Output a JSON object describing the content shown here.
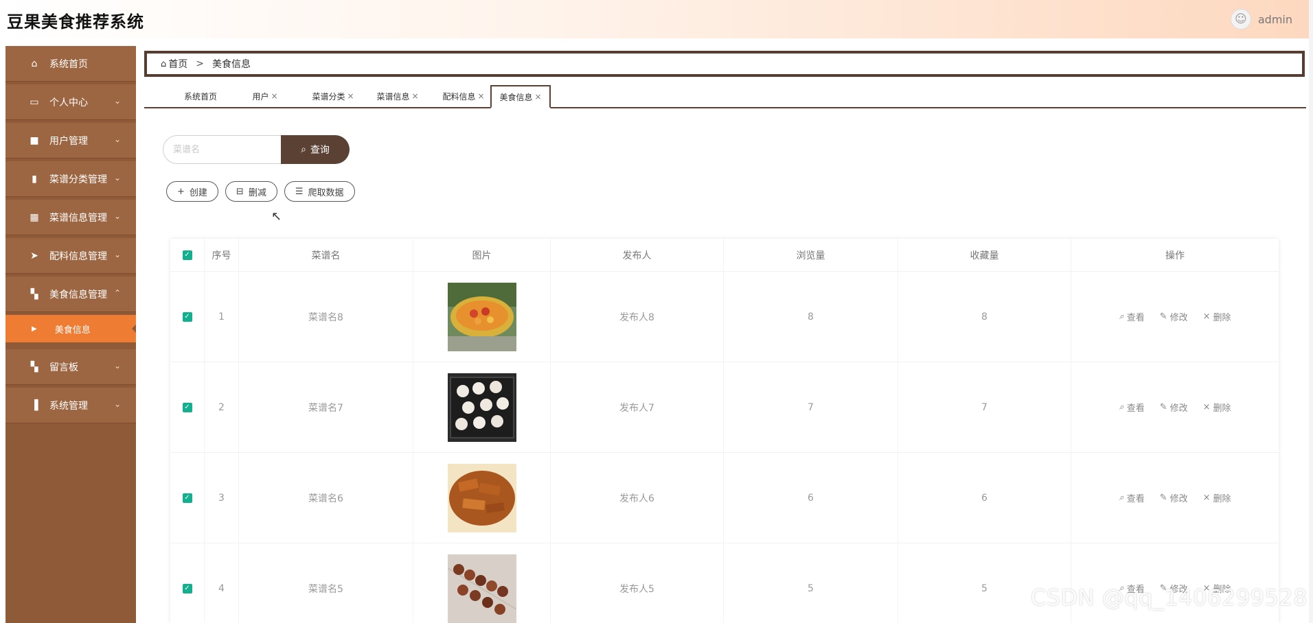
{
  "header": {
    "title": "豆果美食推荐系统",
    "username": "admin"
  },
  "sidebar": {
    "items": [
      {
        "label": "系统首页",
        "icon": "home-icon"
      },
      {
        "label": "个人中心",
        "icon": "card-icon"
      },
      {
        "label": "用户管理",
        "icon": "briefcase-icon"
      },
      {
        "label": "菜谱分类管理",
        "icon": "clipboard-icon"
      },
      {
        "label": "菜谱信息管理",
        "icon": "grid-icon"
      },
      {
        "label": "配料信息管理",
        "icon": "send-icon"
      },
      {
        "label": "美食信息管理",
        "icon": "tiles-icon"
      },
      {
        "label": "留言板",
        "icon": "tiles-icon"
      },
      {
        "label": "系统管理",
        "icon": "bar-chart-icon"
      }
    ],
    "active_sub": "美食信息"
  },
  "breadcrumb": {
    "home": "首页",
    "sep": ">",
    "current": "美食信息"
  },
  "tabs": [
    {
      "label": "系统首页"
    },
    {
      "label": "用户"
    },
    {
      "label": "菜谱分类"
    },
    {
      "label": "菜谱信息"
    },
    {
      "label": "配料信息"
    },
    {
      "label": "美食信息"
    }
  ],
  "search": {
    "placeholder": "菜谱名",
    "button": "查询"
  },
  "actions": {
    "create": "创建",
    "delete": "删减",
    "crawl": "爬取数据"
  },
  "table": {
    "columns": [
      "序号",
      "菜谱名",
      "图片",
      "发布人",
      "浏览量",
      "收藏量",
      "操作"
    ],
    "ops": {
      "view": "查看",
      "edit": "修改",
      "delete": "删除"
    },
    "rows": [
      {
        "no": "1",
        "name": "菜谱名8",
        "publisher": "发布人8",
        "views": "8",
        "favs": "8",
        "image": "pineapple-rice-photo"
      },
      {
        "no": "2",
        "name": "菜谱名7",
        "publisher": "发布人7",
        "views": "7",
        "favs": "7",
        "image": "dumplings-photo"
      },
      {
        "no": "3",
        "name": "菜谱名6",
        "publisher": "发布人6",
        "views": "6",
        "favs": "6",
        "image": "fried-tofu-photo"
      },
      {
        "no": "4",
        "name": "菜谱名5",
        "publisher": "发布人5",
        "views": "5",
        "favs": "5",
        "image": "skewers-photo"
      }
    ]
  },
  "watermark": "CSDN @qq_1406299528",
  "colors": {
    "sidebar": "#8f5a38",
    "active": "#ee7c33",
    "dark": "#5b4134",
    "check": "#12b08f"
  }
}
